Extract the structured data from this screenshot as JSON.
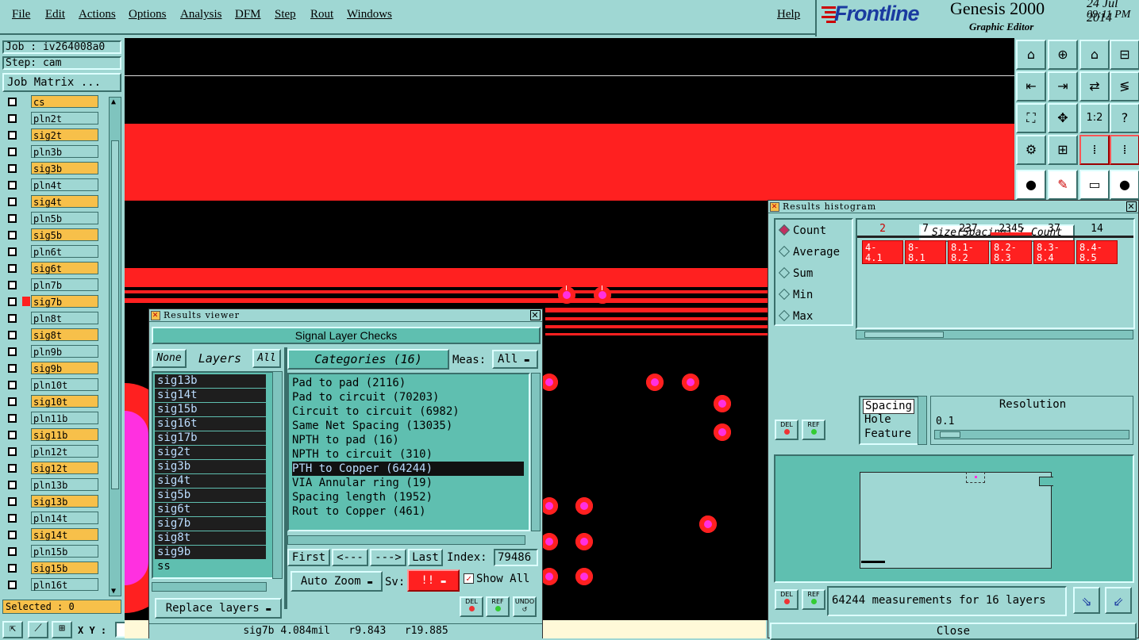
{
  "menu": [
    "File",
    "Edit",
    "Actions",
    "Options",
    "Analysis",
    "DFM",
    "Step",
    "Rout",
    "Windows"
  ],
  "help": "Help",
  "brand": {
    "logo": "Frontline",
    "product": "Genesis 2000",
    "subtitle": "Graphic Editor",
    "date": "24 Jul 2014",
    "time": "09:11 PM"
  },
  "job": {
    "job_label": "Job : iv264008a0",
    "step_label": "Step: cam",
    "matrix_button": "Job Matrix ..."
  },
  "layers": [
    "cs",
    "pln2t",
    "sig2t",
    "pln3b",
    "sig3b",
    "pln4t",
    "sig4t",
    "pln5b",
    "sig5b",
    "pln6t",
    "sig6t",
    "pln7b",
    "sig7b",
    "pln8t",
    "sig8t",
    "pln9b",
    "sig9b",
    "pln10t",
    "sig10t",
    "pln11b",
    "sig11b",
    "pln12t",
    "sig12t",
    "pln13b",
    "sig13b",
    "pln14t",
    "sig14t",
    "pln15b",
    "sig15b",
    "pln16t"
  ],
  "status": {
    "selected": "Selected : 0",
    "xy": "X Y :"
  },
  "results_viewer": {
    "title": "Results viewer",
    "header": "Signal Layer Checks",
    "none_btn": "None",
    "layers_label": "Layers",
    "all_btn": "All",
    "categories_label": "Categories (16)",
    "meas_label": "Meas:",
    "meas_value": "All",
    "layer_list": [
      "sig13b",
      "sig14t",
      "sig15b",
      "sig16t",
      "sig17b",
      "sig2t",
      "sig3b",
      "sig4t",
      "sig5b",
      "sig6t",
      "sig7b",
      "sig8t",
      "sig9b",
      "ss"
    ],
    "categories": [
      "Pad to pad (2116)",
      "Pad to circuit (70203)",
      "Circuit to circuit (6982)",
      "Same Net Spacing (13035)",
      "NPTH to pad (16)",
      "NPTH to circuit (310)",
      "PTH to Copper (64244)",
      "VIA Annular ring (19)",
      "Spacing length (1952)",
      "Rout to Copper (461)"
    ],
    "selected_category": "PTH to Copper (64244)",
    "nav": {
      "first": "First",
      "prev": "<---",
      "next": "--->",
      "last": "Last",
      "index_label": "Index:",
      "index_value": "79486"
    },
    "auto_zoom": "Auto Zoom",
    "sv_label": "Sv:",
    "sv_value": "!!",
    "show_all": "Show All",
    "replace_layers": "Replace layers",
    "del": "DEL",
    "ref": "REF",
    "undo": "UNDO",
    "status_line": "sig7b 4.084mil   r9.843   r19.885"
  },
  "histogram": {
    "title": "Results histogram",
    "modes": [
      "Count",
      "Average",
      "Sum",
      "Min",
      "Max"
    ],
    "selected_mode": "Count",
    "chart_title": "Size(Spacing) / Count",
    "counts": [
      "2",
      "7",
      "237",
      "2345",
      "37",
      "14"
    ],
    "bins": [
      "4-\n4.1",
      "8-\n8.1",
      "8.1-\n8.2",
      "8.2-\n8.3",
      "8.3-\n8.4",
      "8.4-\n8.5"
    ],
    "types": [
      "Spacing",
      "Hole",
      "Feature"
    ],
    "resolution_label": "Resolution",
    "resolution_value": "0.1",
    "measurements": "64244 measurements for 16 layers",
    "close": "Close",
    "del": "DEL",
    "ref": "REF"
  },
  "colors": {
    "panel": "#9fd7d3",
    "signal": "#f7c04a",
    "copper": "#ff2020",
    "pad_center": "#ff30e0",
    "teal": "#5fbfb0"
  }
}
